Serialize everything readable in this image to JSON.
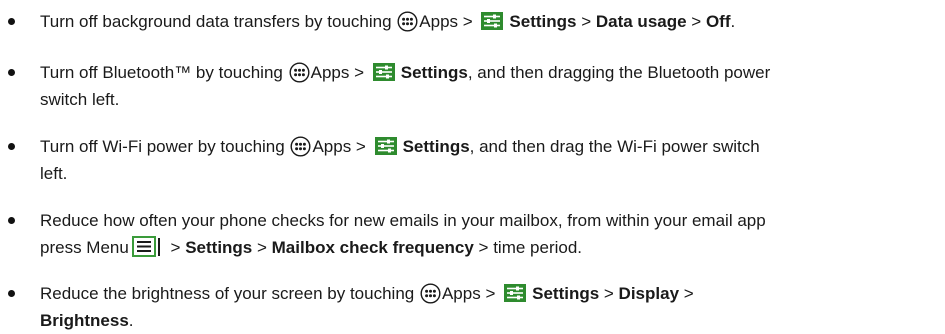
{
  "items": [
    {
      "t1": "Turn off background data transfers by touching",
      "t2": "Apps >",
      "settings": "Settings",
      "sep1": " > ",
      "b2": "Data usage",
      "sep2": " > ",
      "b3": "Off",
      "end": "."
    },
    {
      "t1": "Turn off Bluetooth™ by touching",
      "t2": "Apps >",
      "settings": "Settings",
      "t3": ", and then dragging the Bluetooth power",
      "t4": "switch left."
    },
    {
      "t1": "Turn off Wi-Fi power by touching",
      "t2": "Apps >",
      "settings": "Settings",
      "t3": ", and then drag the Wi-Fi power switch",
      "t4": "left."
    },
    {
      "t1": "Reduce how often your phone checks for new emails in your mailbox, from within your email app",
      "t2": "press Menu",
      "sep1": " > ",
      "settings": "Settings",
      "sep2": " > ",
      "b2": "Mailbox check frequency",
      "t3": " > time period."
    },
    {
      "t1": "Reduce the brightness of your screen by touching",
      "t2": "Apps >",
      "settings": "Settings",
      "sep1": " > ",
      "b2": "Display",
      "sep2": " >",
      "b3": "Brightness",
      "end": "."
    }
  ],
  "icons": {
    "apps": "apps-icon",
    "settings": "settings-icon",
    "menu": "menu-icon",
    "settings_color": "#2e8b2e",
    "menu_color": "#3a9b3a"
  }
}
